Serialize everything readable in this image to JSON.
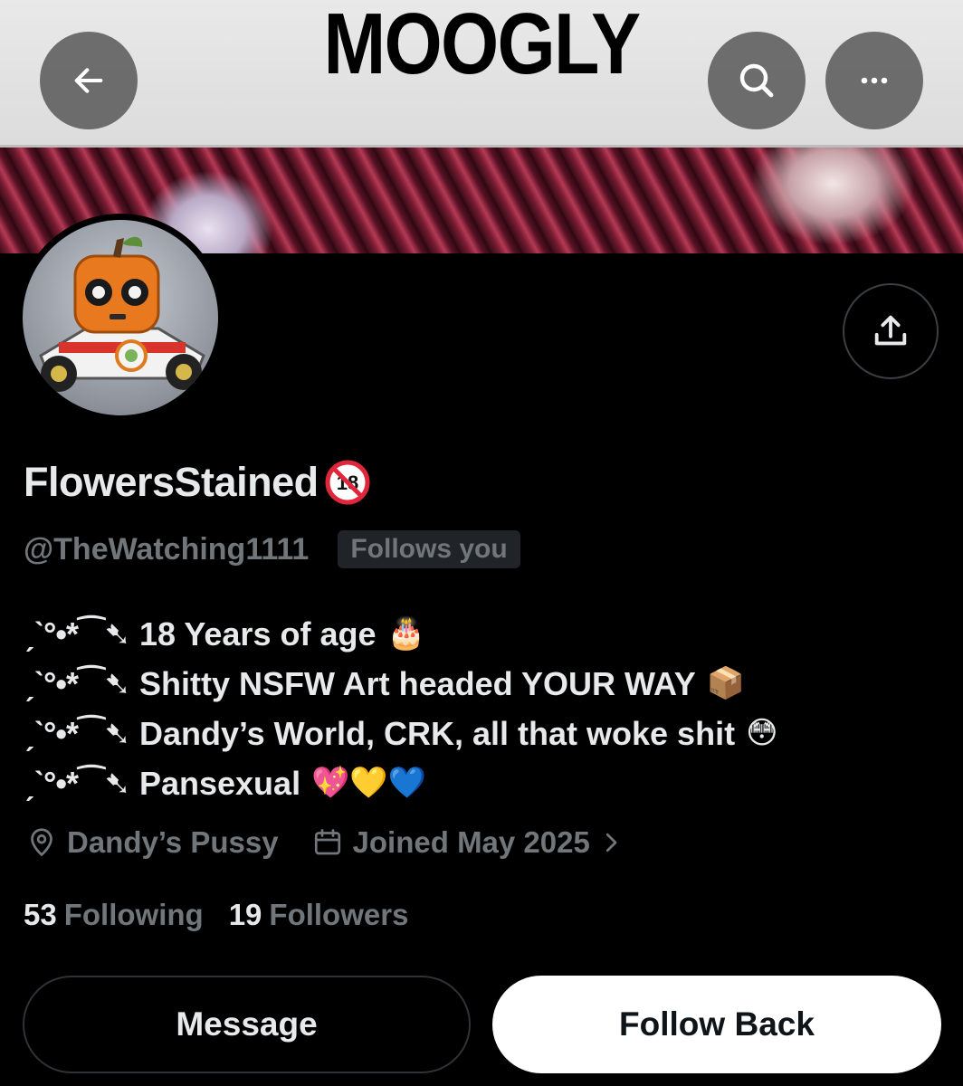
{
  "header": {
    "banner_title": "MOOGLY",
    "back_icon": "arrow-left-icon",
    "search_icon": "search-icon",
    "more_icon": "more-horizontal-icon",
    "share_icon": "share-icon"
  },
  "profile": {
    "display_name": "FlowersStained",
    "age_badge": "18",
    "handle": "@TheWatching1111",
    "follows_you": "Follows you",
    "bio": [
      {
        "deco": "ˏˋ°•*⁀➷",
        "text": "18 Years of age",
        "emoji": "🎂"
      },
      {
        "deco": "ˏˋ°•*⁀➷",
        "text": "Shitty NSFW Art headed YOUR WAY",
        "emoji": "📦"
      },
      {
        "deco": "ˏˋ°•*⁀➷",
        "text": "Dandy’s World, CRK, all that woke shit",
        "emoji": "😳"
      },
      {
        "deco": "ˏˋ°•*⁀➷",
        "text": "Pansexual",
        "emoji": "💖💛💙"
      }
    ],
    "location": "Dandy’s Pussy",
    "joined": "Joined May 2025",
    "following_count": "53",
    "following_label": "Following",
    "followers_count": "19",
    "followers_label": "Followers"
  },
  "actions": {
    "message_label": "Message",
    "follow_back_label": "Follow Back"
  },
  "colors": {
    "background": "#000000",
    "primary_text": "#e7e9ea",
    "secondary_text": "#71767b",
    "badge_bg": "#202327",
    "button_dark_border": "#2f3336",
    "button_light_bg": "#ffffff"
  }
}
